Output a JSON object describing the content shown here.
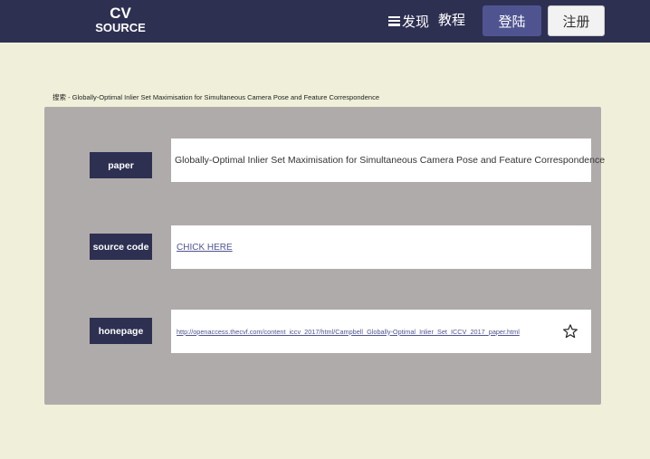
{
  "header": {
    "logo_line1": "CV",
    "logo_line2": "SOURCE",
    "nav": {
      "discover": "发现",
      "tutorial": "教程"
    },
    "login": "登陆",
    "register": "注册"
  },
  "breadcrumb": "搜索 - Globally-Optimal Inlier Set Maximisation for Simultaneous Camera Pose and Feature Correspondence",
  "rows": {
    "paper": {
      "label": "paper",
      "value": "Globally-Optimal Inlier Set Maximisation for Simultaneous Camera Pose and Feature Correspondence"
    },
    "source_code": {
      "label": "source code",
      "value": "CHICK HERE"
    },
    "homepage": {
      "label": "honepage",
      "value": "http://openaccess.thecvf.com/content_iccv_2017/html/Campbell_Globally-Optimal_Inlier_Set_ICCV_2017_paper.html",
      "icon": "star-icon"
    }
  },
  "colors": {
    "navbar": "#2e3052",
    "background": "#f0f0da",
    "panel": "#b0abab",
    "accent": "#4f5491"
  }
}
